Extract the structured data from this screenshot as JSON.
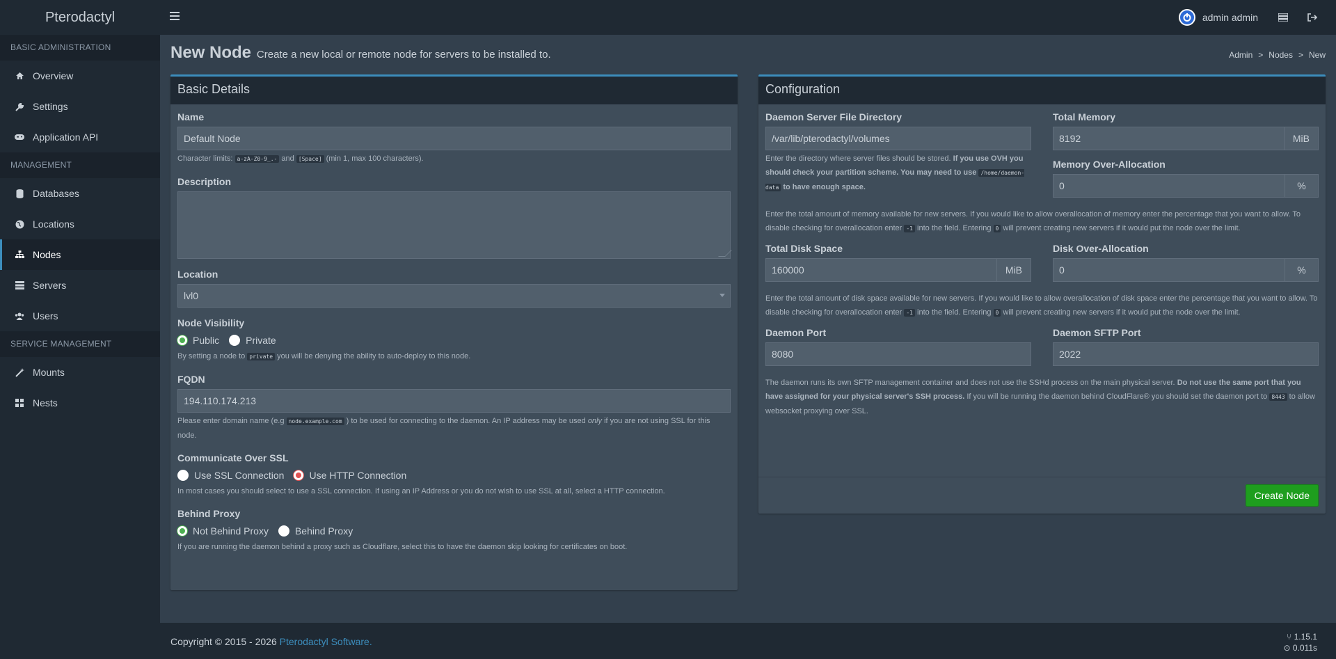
{
  "header": {
    "brand": "Pterodactyl",
    "user_name": "admin admin"
  },
  "sidebar": {
    "sections": [
      {
        "title": "BASIC ADMINISTRATION",
        "items": [
          {
            "label": "Overview",
            "icon": "home-icon"
          },
          {
            "label": "Settings",
            "icon": "wrench-icon"
          },
          {
            "label": "Application API",
            "icon": "gamepad-icon"
          }
        ]
      },
      {
        "title": "MANAGEMENT",
        "items": [
          {
            "label": "Databases",
            "icon": "database-icon"
          },
          {
            "label": "Locations",
            "icon": "globe-icon"
          },
          {
            "label": "Nodes",
            "icon": "sitemap-icon",
            "active": true
          },
          {
            "label": "Servers",
            "icon": "server-icon"
          },
          {
            "label": "Users",
            "icon": "users-icon"
          }
        ]
      },
      {
        "title": "SERVICE MANAGEMENT",
        "items": [
          {
            "label": "Mounts",
            "icon": "magic-icon"
          },
          {
            "label": "Nests",
            "icon": "th-large-icon"
          }
        ]
      }
    ]
  },
  "page": {
    "title": "New Node",
    "subtitle": "Create a new local or remote node for servers to be installed to.",
    "breadcrumb": [
      "Admin",
      "Nodes",
      "New"
    ]
  },
  "basic": {
    "title": "Basic Details",
    "name_label": "Name",
    "name_value": "Default Node",
    "name_help_1": "Character limits:",
    "name_help_code1": "a-zA-Z0-9_.-",
    "name_help_and": "and",
    "name_help_code2": "[Space]",
    "name_help_2": "(min 1, max 100 characters).",
    "desc_label": "Description",
    "location_label": "Location",
    "location_value": "lvl0",
    "visibility_label": "Node Visibility",
    "vis_public": "Public",
    "vis_private": "Private",
    "vis_help_1": "By setting a node to",
    "vis_help_code": "private",
    "vis_help_2": "you will be denying the ability to auto-deploy to this node.",
    "fqdn_label": "FQDN",
    "fqdn_value": "194.110.174.213",
    "fqdn_help_1": "Please enter domain name (e.g",
    "fqdn_help_code": "node.example.com",
    "fqdn_help_2": ") to be used for connecting to the daemon. An IP address may be used",
    "fqdn_help_only": "only",
    "fqdn_help_3": "if you are not using SSL for this node.",
    "ssl_label": "Communicate Over SSL",
    "ssl_opt1": "Use SSL Connection",
    "ssl_opt2": "Use HTTP Connection",
    "ssl_help": "In most cases you should select to use a SSL connection. If using an IP Address or you do not wish to use SSL at all, select a HTTP connection.",
    "proxy_label": "Behind Proxy",
    "proxy_opt1": "Not Behind Proxy",
    "proxy_opt2": "Behind Proxy",
    "proxy_help": "If you are running the daemon behind a proxy such as Cloudflare, select this to have the daemon skip looking for certificates on boot."
  },
  "config": {
    "title": "Configuration",
    "dir_label": "Daemon Server File Directory",
    "dir_value": "/var/lib/pterodactyl/volumes",
    "dir_help_1": "Enter the directory where server files should be stored.",
    "dir_help_bold": "If you use OVH you should check your partition scheme. You may need to use",
    "dir_help_code": "/home/daemon-data",
    "dir_help_bold2": "to have enough space.",
    "mem_label": "Total Memory",
    "mem_value": "8192",
    "mem_unit": "MiB",
    "mem_over_label": "Memory Over-Allocation",
    "mem_over_value": "0",
    "mem_over_unit": "%",
    "mem_help_1": "Enter the total amount of memory available for new servers. If you would like to allow overallocation of memory enter the percentage that you want to allow. To disable checking for overallocation enter",
    "mem_help_code1": "-1",
    "mem_help_2": "into the field. Entering",
    "mem_help_code2": "0",
    "mem_help_3": "will prevent creating new servers if it would put the node over the limit.",
    "disk_label": "Total Disk Space",
    "disk_value": "160000",
    "disk_unit": "MiB",
    "disk_over_label": "Disk Over-Allocation",
    "disk_over_value": "0",
    "disk_over_unit": "%",
    "disk_help_1": "Enter the total amount of disk space available for new servers. If you would like to allow overallocation of disk space enter the percentage that you want to allow. To disable checking for overallocation enter",
    "disk_help_code1": "-1",
    "disk_help_2": "into the field. Entering",
    "disk_help_code2": "0",
    "disk_help_3": "will prevent creating new servers if it would put the node over the limit.",
    "port_label": "Daemon Port",
    "port_value": "8080",
    "sftp_label": "Daemon SFTP Port",
    "sftp_value": "2022",
    "port_help_1": "The daemon runs its own SFTP management container and does not use the SSHd process on the main physical server.",
    "port_help_bold": "Do not use the same port that you have assigned for your physical server's SSH process.",
    "port_help_2": "If you will be running the daemon behind CloudFlare® you should set the daemon port to",
    "port_help_code": "8443",
    "port_help_3": "to allow websocket proxying over SSL.",
    "create_button": "Create Node"
  },
  "footer": {
    "copyright": "Copyright © 2015 - 2026",
    "link": "Pterodactyl Software.",
    "version": "1.15.1",
    "time": "0.011s"
  }
}
